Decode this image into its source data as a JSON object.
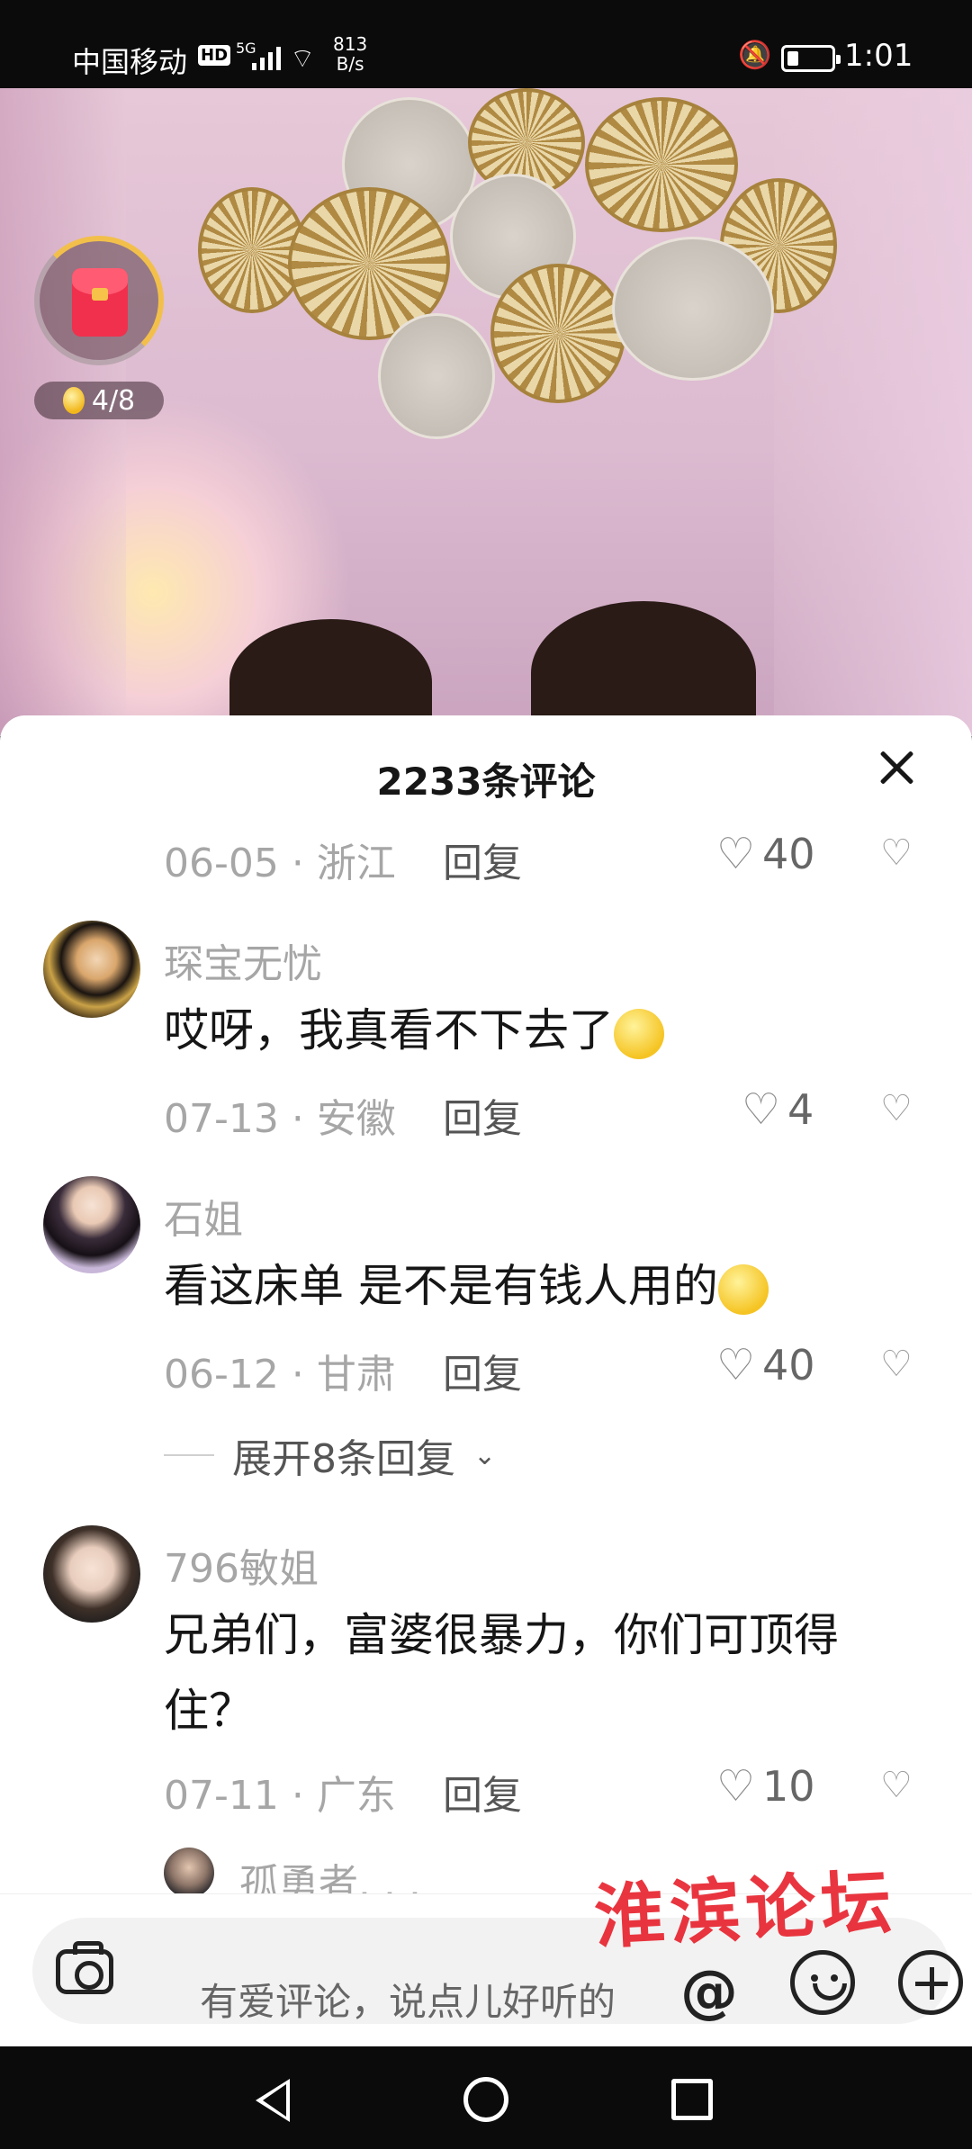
{
  "status_bar": {
    "carrier": "中国移动",
    "hd": "HD",
    "network": "5G",
    "speed_value": "813",
    "speed_unit": "B/s",
    "time": "1:01"
  },
  "video_overlay": {
    "coin_counter": "4/8"
  },
  "comments": {
    "title": "2233条评论",
    "reply_label": "回复",
    "items": [
      {
        "username": "",
        "text": "",
        "meta": "06-05 · 浙江",
        "likes": "40"
      },
      {
        "username": "琛宝无忧",
        "text": "哎呀，我真看不下去了",
        "meta": "07-13 · 安徽",
        "likes": "4"
      },
      {
        "username": "石姐",
        "text": "看这床单  是不是有钱人用的",
        "meta": "06-12 · 甘肃",
        "likes": "40"
      },
      {
        "username": "796敏姐",
        "text": "兄弟们，富婆很暴力，你们可顶得住？",
        "meta": "07-11 · 广东",
        "likes": "10"
      },
      {
        "username": "孤勇者. . ."
      }
    ],
    "expand_replies": "展开8条回复"
  },
  "input": {
    "placeholder": "有爱评论，说点儿好听的",
    "at_symbol": "@"
  },
  "watermark": "淮滨论坛"
}
